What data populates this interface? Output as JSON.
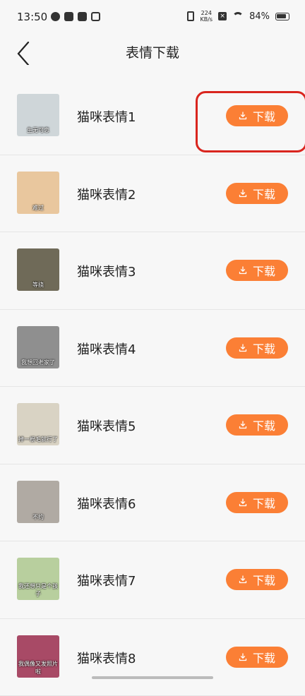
{
  "status_bar": {
    "time": "13:50",
    "net_speed_value": "224",
    "net_speed_unit": "KB/s",
    "battery": "84%"
  },
  "header": {
    "title": "表情下载",
    "back_icon": "chevron-left-icon"
  },
  "download_label": "下载",
  "items": [
    {
      "name": "猫咪表情1",
      "thumb_caption": "生无可恋",
      "thumb_color": "#cfd6d9"
    },
    {
      "name": "猫咪表情2",
      "thumb_caption": "难过",
      "thumb_color": "#e9c79e"
    },
    {
      "name": "猫咪表情3",
      "thumb_caption": "等挠",
      "thumb_color": "#6f6a58"
    },
    {
      "name": "猫咪表情4",
      "thumb_caption": "我想回老家了",
      "thumb_color": "#8f8f8f"
    },
    {
      "name": "猫咪表情5",
      "thumb_caption": "掉一根毛就行了",
      "thumb_color": "#d9d3c4"
    },
    {
      "name": "猫咪表情6",
      "thumb_caption": "不约",
      "thumb_color": "#b0aaa3"
    },
    {
      "name": "猫咪表情7",
      "thumb_caption": "我还想只是个孩子",
      "thumb_color": "#b8cf9e"
    },
    {
      "name": "猫咪表情8",
      "thumb_caption": "我偶像又发照片啦",
      "thumb_color": "#a84a66"
    }
  ],
  "colors": {
    "accent": "#fb7f35",
    "highlight": "#d9251e"
  }
}
